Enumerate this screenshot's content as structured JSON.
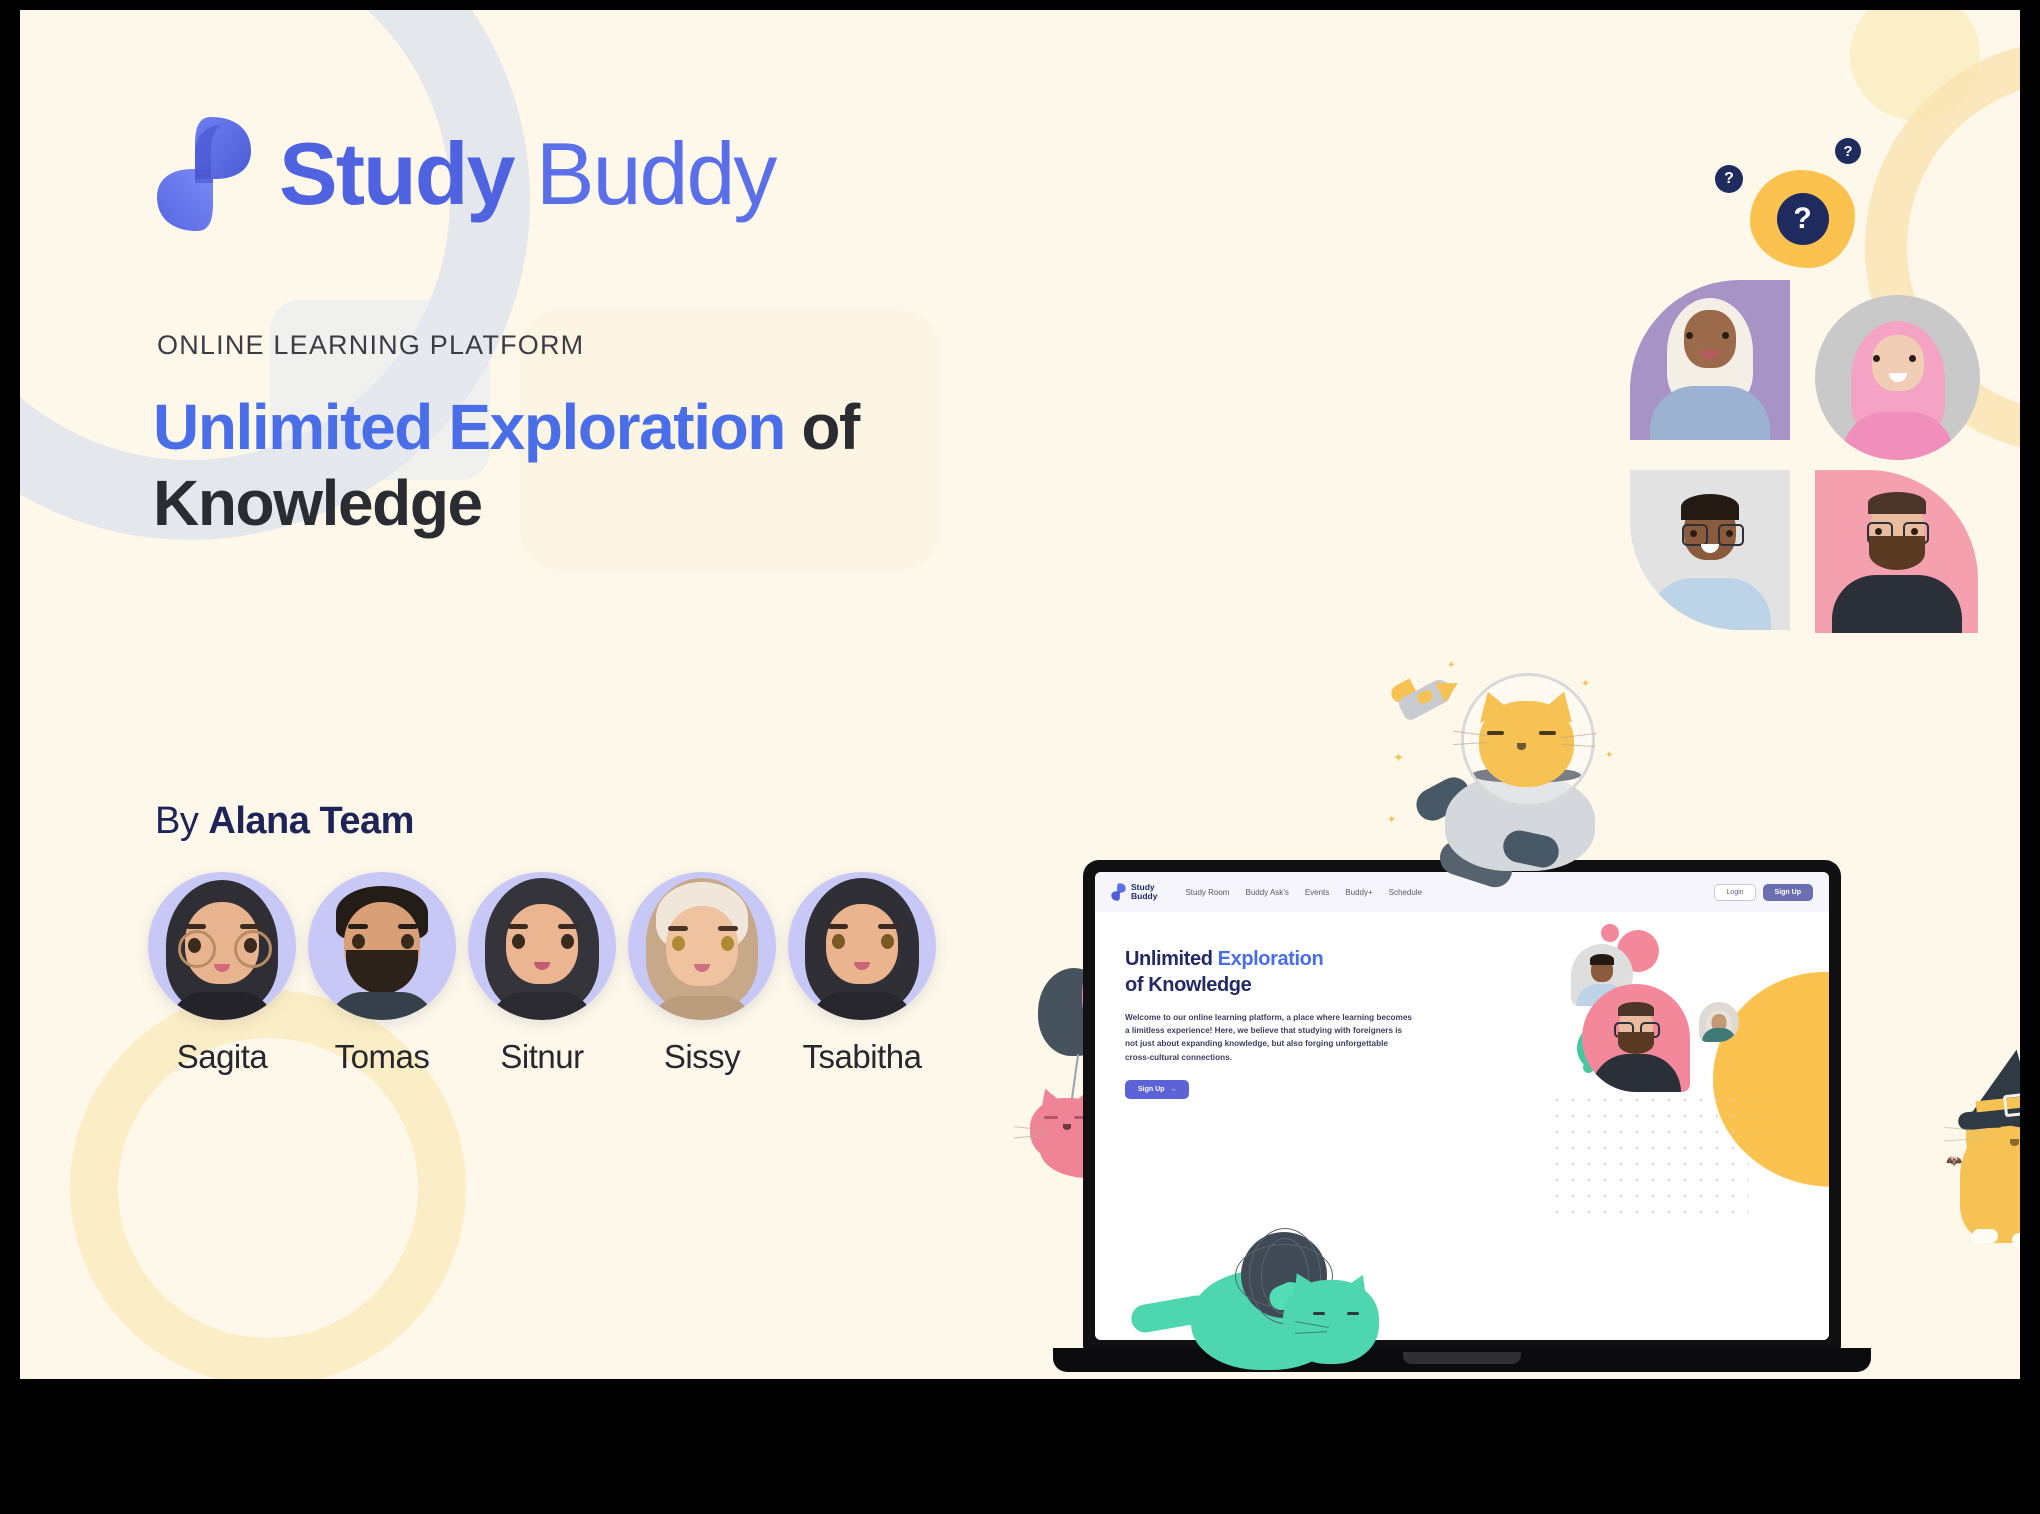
{
  "slide": {
    "brand": {
      "name_bold": "Study",
      "name_light": "Buddy",
      "logo_icon": "study-buddy-s-logo"
    },
    "eyebrow": "ONLINE LEARNING PLATFORM",
    "headline": {
      "highlight": "Unlimited Exploration",
      "rest": " of",
      "line2": "Knowledge"
    },
    "byline": {
      "prefix": "By ",
      "team": "Alana Team"
    },
    "team": [
      {
        "name": "Sagita"
      },
      {
        "name": "Tomas"
      },
      {
        "name": "Sitnur"
      },
      {
        "name": "Sissy"
      },
      {
        "name": "Tsabitha"
      }
    ],
    "badges": {
      "question": "?"
    },
    "colors": {
      "background": "#fdf8ea",
      "brand_blue": "#5b6fe8",
      "headline_blue": "#4a6ee8",
      "headline_dark": "#2b2b32",
      "navy": "#1f2a5e",
      "yellow": "#fbc24f",
      "pink": "#f4889b",
      "green": "#4ed6ae",
      "lavender": "#c7c8f5"
    }
  },
  "mockup": {
    "site": {
      "logo_line1": "Study",
      "logo_line2": "Buddy",
      "nav": [
        "Study Room",
        "Buddy Ask's",
        "Events",
        "Buddy+",
        "Schedule"
      ],
      "login_label": "Login",
      "signup_label": "Sign Up",
      "hero_title_1": "Unlimited ",
      "hero_title_accent": "Exploration",
      "hero_title_2": "of Knowledge",
      "hero_paragraph": "Welcome to our online learning platform, a place where learning becomes a limitless experience! Here, we believe that studying with foreigners is not just about expanding knowledge, but also forging unforgettable cross-cultural connections.",
      "cta_label": "Sign Up",
      "cta_arrow": "→"
    }
  }
}
